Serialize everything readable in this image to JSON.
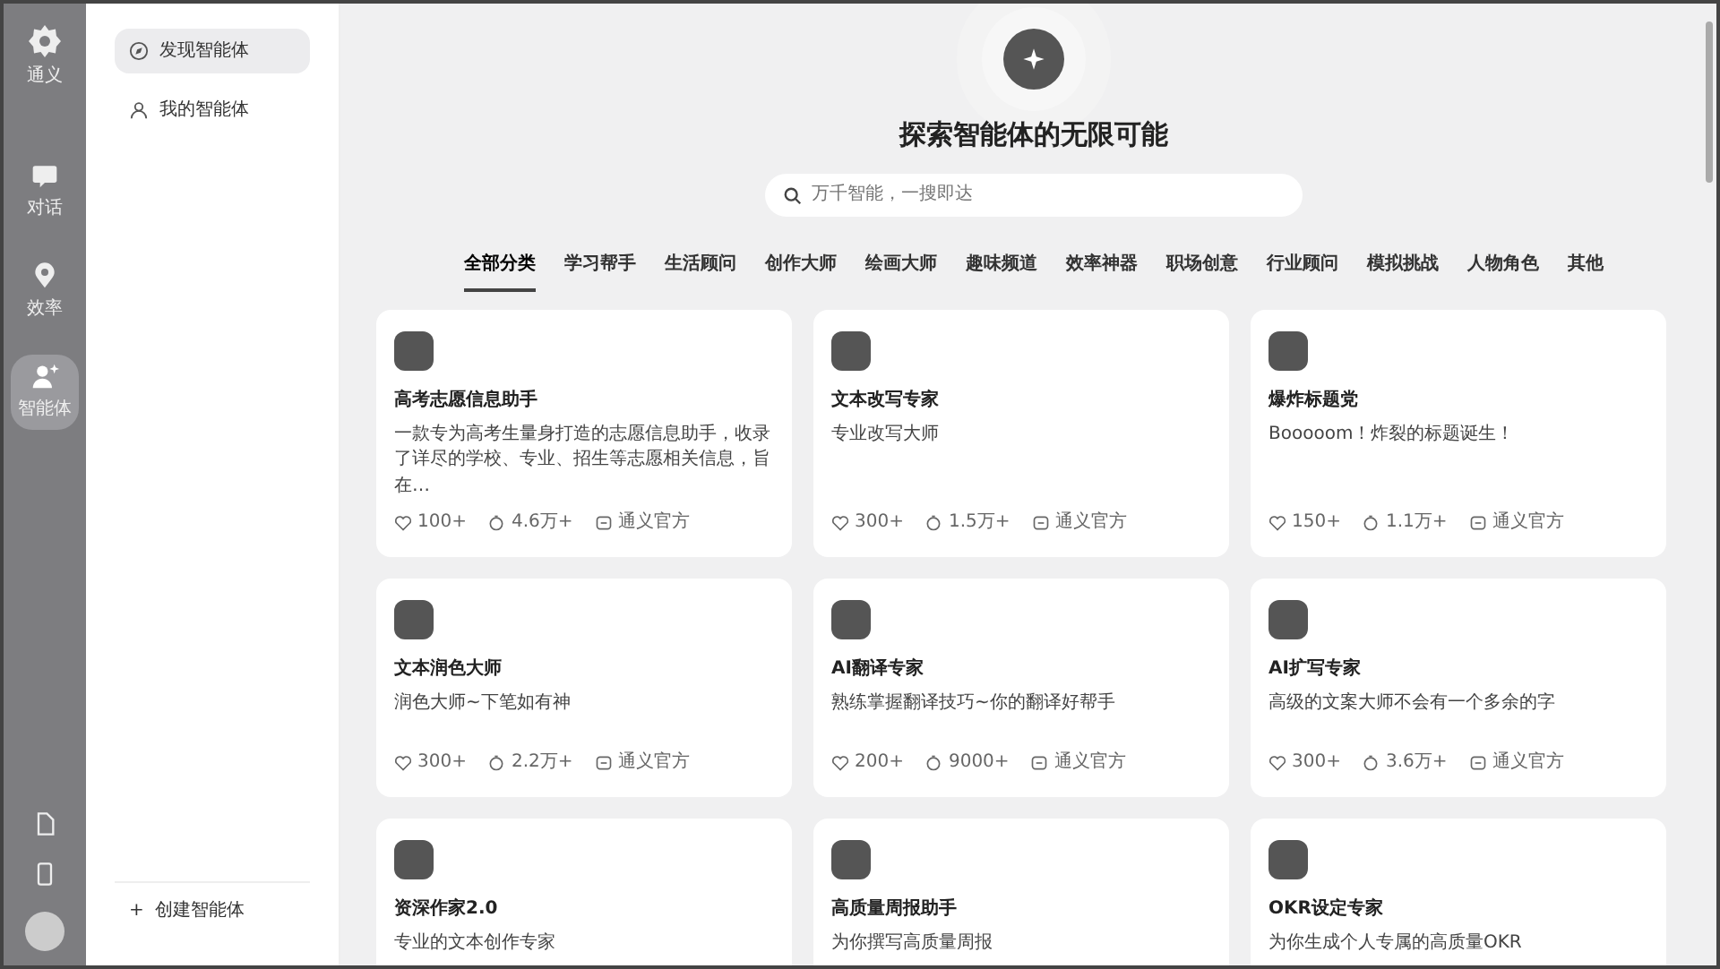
{
  "rail": {
    "logo_label": "通义",
    "items": [
      {
        "kind": "chat",
        "label": "对话",
        "selected": false
      },
      {
        "kind": "pin",
        "label": "效率",
        "selected": false
      },
      {
        "kind": "agent",
        "label": "智能体",
        "selected": true
      }
    ],
    "bottom": [
      {
        "kind": "doc"
      },
      {
        "kind": "phone"
      },
      {
        "kind": "avatar"
      }
    ]
  },
  "sidebar": {
    "items": [
      {
        "kind": "discover",
        "label": "发现智能体",
        "selected": true
      },
      {
        "kind": "mine",
        "label": "我的智能体",
        "selected": false
      }
    ],
    "create": {
      "icon": "+",
      "label": "创建智能体"
    }
  },
  "hero": {
    "title": "探索智能体的无限可能",
    "search": {
      "placeholder": "万千智能，一搜即达"
    }
  },
  "tabs": [
    {
      "label": "全部分类",
      "selected": true
    },
    {
      "label": "学习帮手",
      "selected": false
    },
    {
      "label": "生活顾问",
      "selected": false
    },
    {
      "label": "创作大师",
      "selected": false
    },
    {
      "label": "绘画大师",
      "selected": false
    },
    {
      "label": "趣味频道",
      "selected": false
    },
    {
      "label": "效率神器",
      "selected": false
    },
    {
      "label": "职场创意",
      "selected": false
    },
    {
      "label": "行业顾问",
      "selected": false
    },
    {
      "label": "模拟挑战",
      "selected": false
    },
    {
      "label": "人物角色",
      "selected": false
    },
    {
      "label": "其他",
      "selected": false
    }
  ],
  "cards": [
    {
      "name": "高考志愿信息助手",
      "desc": "一款专为高考生量身打造的志愿信息助手，收录了详尽的学校、专业、招生等志愿相关信息，旨在…",
      "likes": "100+",
      "uses": "4.6万+",
      "author": "通义官方"
    },
    {
      "name": "文本改写专家",
      "desc": "专业改写大师",
      "likes": "300+",
      "uses": "1.5万+",
      "author": "通义官方"
    },
    {
      "name": "爆炸标题党",
      "desc": "Booooom！炸裂的标题诞生！",
      "likes": "150+",
      "uses": "1.1万+",
      "author": "通义官方"
    },
    {
      "name": "文本润色大师",
      "desc": "润色大师~下笔如有神",
      "likes": "300+",
      "uses": "2.2万+",
      "author": "通义官方"
    },
    {
      "name": "AI翻译专家",
      "desc": "熟练掌握翻译技巧~你的翻译好帮手",
      "likes": "200+",
      "uses": "9000+",
      "author": "通义官方"
    },
    {
      "name": "AI扩写专家",
      "desc": "高级的文案大师不会有一个多余的字",
      "likes": "300+",
      "uses": "3.6万+",
      "author": "通义官方"
    },
    {
      "name": "资深作家2.0",
      "desc": "专业的文本创作专家"
    },
    {
      "name": "高质量周报助手",
      "desc": "为你撰写高质量周报"
    },
    {
      "name": "OKR设定专家",
      "desc": "为你生成个人专属的高质量OKR"
    }
  ]
}
